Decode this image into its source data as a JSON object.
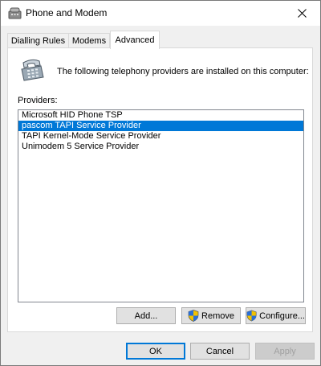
{
  "window": {
    "title": "Phone and Modem"
  },
  "tabs": [
    {
      "label": "Dialling Rules",
      "active": false
    },
    {
      "label": "Modems",
      "active": false
    },
    {
      "label": "Advanced",
      "active": true
    }
  ],
  "advanced": {
    "intro_text": "The following telephony providers are installed on this computer:",
    "providers_label": "Providers:",
    "providers": [
      {
        "label": "Microsoft HID Phone TSP",
        "selected": false
      },
      {
        "label": "pascom TAPI Service Provider",
        "selected": true
      },
      {
        "label": "TAPI Kernel-Mode Service Provider",
        "selected": false
      },
      {
        "label": "Unimodem 5 Service Provider",
        "selected": false
      }
    ],
    "buttons": {
      "add": "Add...",
      "remove": "Remove",
      "configure": "Configure..."
    }
  },
  "footer": {
    "ok": "OK",
    "cancel": "Cancel",
    "apply": "Apply"
  },
  "colors": {
    "selection": "#0078d7",
    "window_bg": "#f0f0f0",
    "panel_bg": "#ffffff"
  },
  "icons": {
    "title": "phone-modem-icon",
    "panel": "telephone-icon",
    "close": "close-icon",
    "uac": "uac-shield-icon"
  }
}
